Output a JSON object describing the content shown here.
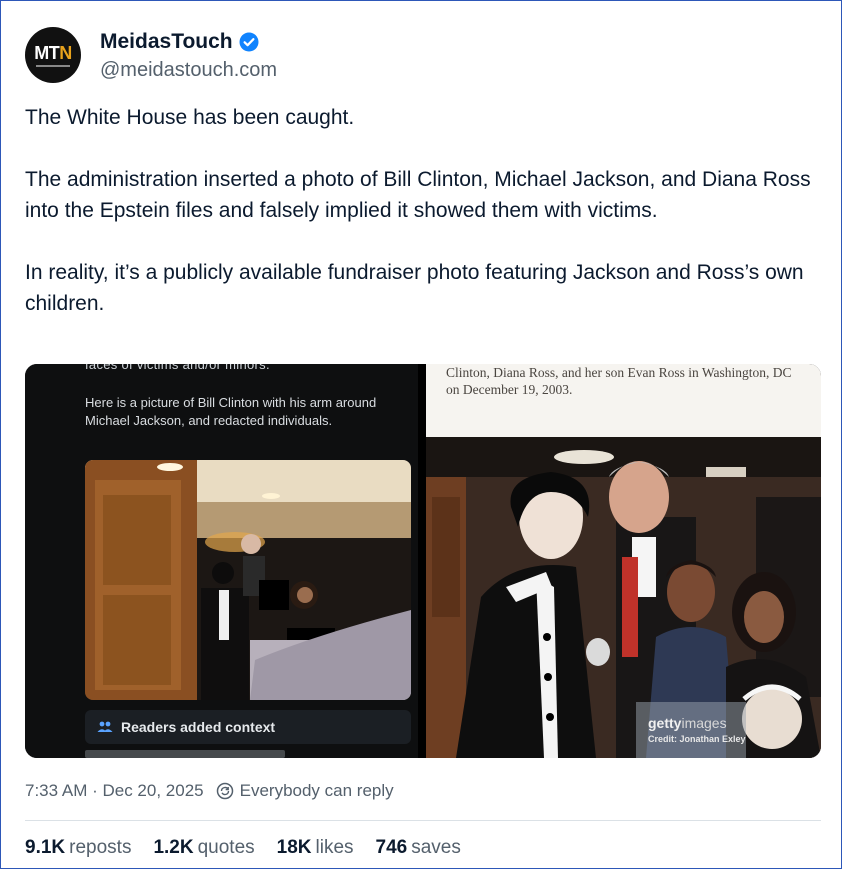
{
  "author": {
    "display_name": "MeidasTouch",
    "handle": "@meidastouch.com",
    "avatar_text": "MTN",
    "verified_icon": "verified-check-icon"
  },
  "post": {
    "paragraphs": [
      "The White House has been caught.",
      "The administration inserted a photo of Bill Clinton, Michael Jackson, and Diana Ross into the Epstein files and falsely implied it showed them with victims.",
      "In reality, it’s a publicly available fundraiser photo featuring Jackson and Ross’s own children."
    ]
  },
  "media": {
    "left": {
      "cut_text": "faces of victims and/or minors.",
      "caption": "Here is a picture of Bill Clinton with his arm around Michael Jackson, and redacted individuals.",
      "context_label": "Readers added context"
    },
    "right": {
      "caption": "Clinton, Diana Ross, and her son Evan Ross in Washington, DC on December 19, 2003.",
      "watermark_brand": "getty",
      "watermark_suffix": "images",
      "watermark_credit": "Credit: Jonathan Exley"
    }
  },
  "meta": {
    "timestamp": "7:33 AM · Dec 20, 2025",
    "reply_setting": "Everybody can reply"
  },
  "stats": [
    {
      "value": "9.1K",
      "label": "reposts"
    },
    {
      "value": "1.2K",
      "label": "quotes"
    },
    {
      "value": "18K",
      "label": "likes"
    },
    {
      "value": "746",
      "label": "saves"
    }
  ],
  "colors": {
    "verified_blue": "#1083fe",
    "text_primary": "#0b1a2e",
    "text_secondary": "#54606c"
  }
}
